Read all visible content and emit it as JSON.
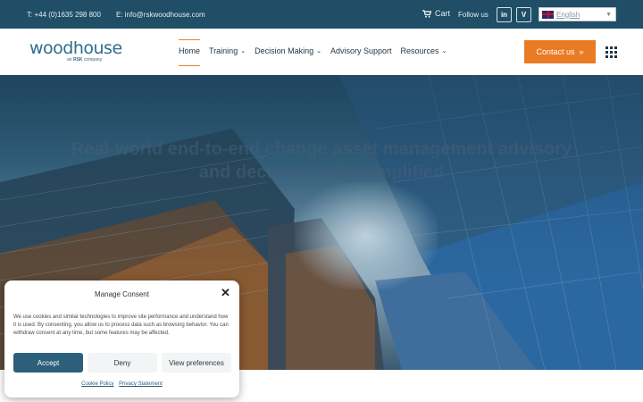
{
  "topbar": {
    "phone": "T: +44 (0)1635 298 800",
    "email": "E: info@rskwoodhouse.com",
    "cart_label": "Cart",
    "follow_label": "Follow us",
    "linkedin_icon": "linkedin-icon",
    "vimeo_icon": "vimeo-icon",
    "language": "English"
  },
  "header": {
    "logo_text": "woodhouse",
    "logo_sub_prefix": "an",
    "logo_sub_brand": "RSK",
    "logo_sub_suffix": "company",
    "nav": [
      {
        "label": "Home",
        "active": true,
        "dropdown": false
      },
      {
        "label": "Training",
        "active": false,
        "dropdown": true
      },
      {
        "label": "Decision Making",
        "active": false,
        "dropdown": true
      },
      {
        "label": "Advisory Support",
        "active": false,
        "dropdown": false
      },
      {
        "label": "Resources",
        "active": false,
        "dropdown": true
      }
    ],
    "contact_label": "Contact us",
    "contact_icon": "double-chevron-right-icon",
    "menu_icon": "grid-menu-icon"
  },
  "hero": {
    "text": "Real-world end-to-end change asset management advisory and decision tools simplified"
  },
  "cookie": {
    "title": "Manage Consent",
    "body": "We use cookies and similar technologies to improve site performance and understand how it is used. By consenting, you allow us to process data such as browsing behavior. You can withdraw consent at any time, but some features may be affected.",
    "accept_label": "Accept",
    "deny_label": "Deny",
    "prefs_label": "View preferences",
    "cookie_policy_label": "Cookie Policy",
    "privacy_label": "Privacy Statement"
  },
  "colors": {
    "topbar": "#1f4e66",
    "accent": "#ea7b25",
    "primary": "#2d5f7c"
  }
}
